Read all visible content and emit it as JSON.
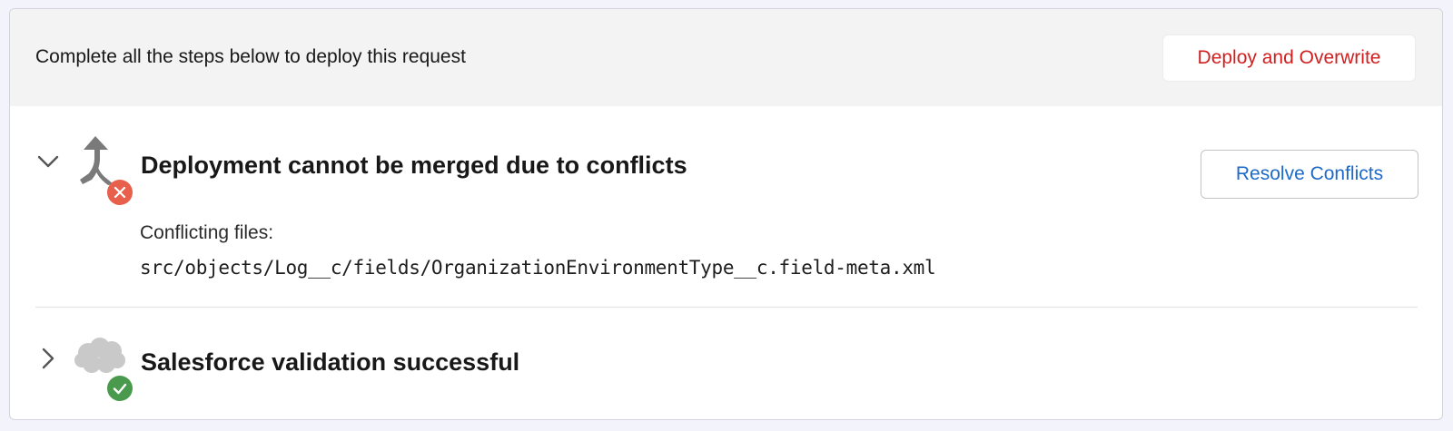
{
  "header": {
    "instruction": "Complete all the steps below to deploy this request",
    "deploy_button_label": "Deploy and Overwrite"
  },
  "steps": [
    {
      "title": "Deployment cannot be merged due to conflicts",
      "status": "error",
      "icon": "merge-icon",
      "status_icon": "error-x-icon",
      "expanded": true,
      "action_label": "Resolve Conflicts",
      "conflicts_label": "Conflicting files:",
      "conflicting_files": [
        "src/objects/Log__c/fields/OrganizationEnvironmentType__c.field-meta.xml"
      ]
    },
    {
      "title": "Salesforce validation successful",
      "status": "success",
      "icon": "salesforce-cloud-icon",
      "status_icon": "success-check-icon",
      "expanded": false
    }
  ],
  "colors": {
    "danger": "#d11f1f",
    "link": "#1d6ac9",
    "error_badge": "#e8604c",
    "success_badge": "#4a9a4e",
    "icon_gray": "#7a7a7a",
    "cloud_gray": "#c9c9c9",
    "header_bg": "#f3f3f3"
  }
}
